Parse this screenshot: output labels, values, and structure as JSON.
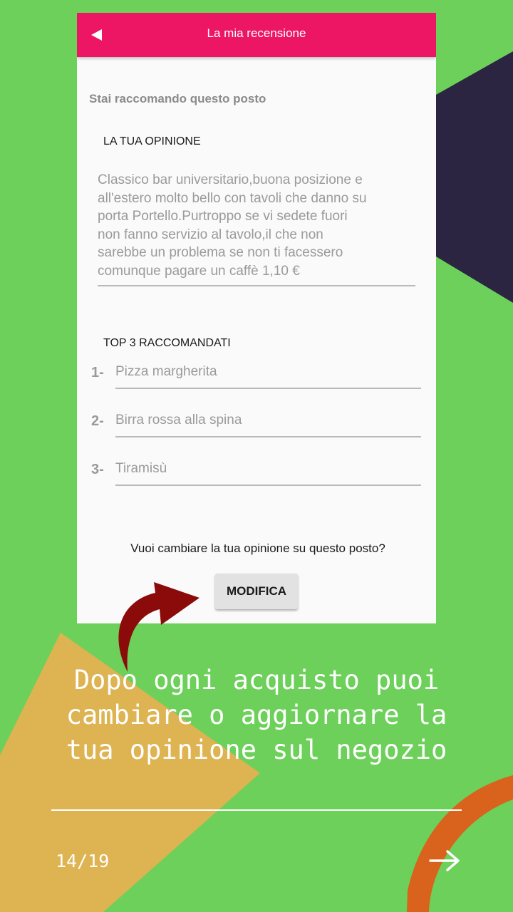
{
  "app_bar": {
    "title": "La mia recensione",
    "back_icon": "back-triangle-icon"
  },
  "review": {
    "subtitle": "Stai raccomando questo posto",
    "opinion_label": "LA TUA OPINIONE",
    "opinion_text": "Classico bar universitario,buona posizione e\nall'estero molto bello con tavoli che danno su\nporta Portello.Purtroppo se vi sedete fuori\nnon fanno servizio al tavolo,il che non\nsarebbe un problema se non ti facessero\ncomunque pagare un caffè 1,10 €",
    "top3_label": "TOP 3 RACCOMANDATI",
    "top3": [
      {
        "rank": "1-",
        "value": "Pizza margherita"
      },
      {
        "rank": "2-",
        "value": "Birra rossa alla spina"
      },
      {
        "rank": "3-",
        "value": "Tiramisù"
      }
    ],
    "question": "Vuoi cambiare la tua opinione su questo posto?",
    "modify_button": "MODIFICA"
  },
  "slide": {
    "caption": "Dopo ogni acquisto puoi\ncambiare o aggiornare la\ntua opinione sul negozio",
    "page_indicator": "14/19",
    "next_icon": "arrow-right-icon"
  },
  "colors": {
    "background_green": "#6dd05a",
    "app_bar_pink": "#ec1664",
    "navy": "#2b2542",
    "mustard": "#deb352",
    "orange": "#d9621c",
    "arrow_red": "#8b0a0a"
  }
}
